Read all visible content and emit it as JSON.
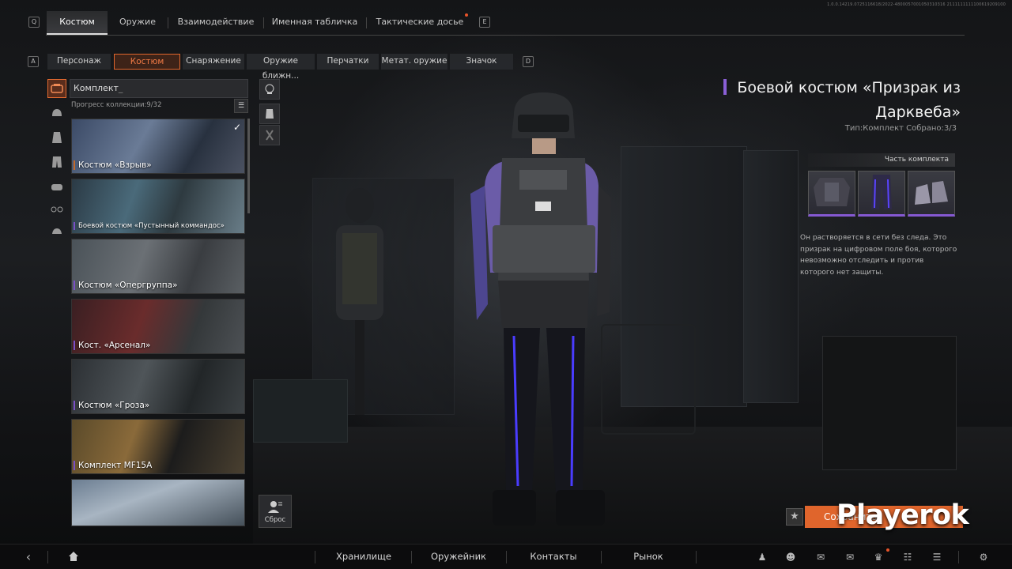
{
  "top_tabs": [
    {
      "key": "Q"
    },
    {
      "label": "Костюм",
      "active": true
    },
    {
      "label": "Оружие"
    },
    {
      "label": "Взаимодействие"
    },
    {
      "label": "Именная табличка"
    },
    {
      "label": "Тактические досье"
    },
    {
      "key": "E"
    }
  ],
  "top_keys": {
    "left": "Q",
    "right": "E"
  },
  "version_text": "1.0.0.14219.0725116618/2022-4800057001050310316 2111111111100619209100",
  "sub_keys": {
    "left": "A",
    "right": "D"
  },
  "sub_tabs": [
    {
      "label": "Персонаж"
    },
    {
      "label": "Костюм",
      "active": true
    },
    {
      "label": "Снаряжение"
    },
    {
      "label": "Оружие ближн..."
    },
    {
      "label": "Перчатки"
    },
    {
      "label": "Метат. оружие"
    },
    {
      "label": "Значок"
    }
  ],
  "categories": [
    "suit-icon",
    "helmet-icon",
    "jacket-icon",
    "pants-icon",
    "gloves-icon",
    "mask-icon",
    "glasses-icon",
    "cap-icon"
  ],
  "collection": {
    "filter_label": "Комплект",
    "progress": "Прогресс коллекции:9/32",
    "cards": [
      {
        "label": "Костюм «Взрыв»",
        "checked": true,
        "rarity": "orange"
      },
      {
        "label": "Боевой костюм «Пустынный коммандос»",
        "rarity": "purple"
      },
      {
        "label": "Костюм «Опергруппа»",
        "rarity": "purple"
      },
      {
        "label": "Кост. «Арсенал»",
        "rarity": "purple"
      },
      {
        "label": "Костюм «Гроза»",
        "rarity": "purple"
      },
      {
        "label": "Комплект MF15A",
        "rarity": "purple"
      },
      {
        "label": "",
        "rarity": "purple"
      }
    ]
  },
  "reset_label": "Сброс",
  "detail": {
    "title_line1": "Боевой костюм «Призрак из",
    "title_line2": "Дарквеба»",
    "type_line": "Тип:Комплект Собрано:3/3",
    "parts_header": "Часть комплекта",
    "parts": [
      "jacket-icon",
      "pants-icon",
      "boots-icon"
    ],
    "description": "Он растворяется в сети без следа. Это призрак на цифровом поле боя, которого невозможно отследить и против которого нет защиты.",
    "save_label": "Сохранить"
  },
  "watermark": "Playerok",
  "bottom_nav": [
    "Хранилище",
    "Оружейник",
    "Контакты",
    "Рынок"
  ],
  "bottom_icons": [
    "friends-icon",
    "profile-icon",
    "chat-icon",
    "mail-icon",
    "trophy-icon",
    "tasks-icon",
    "list-icon",
    "settings-icon"
  ],
  "colors": {
    "accent": "#e0652c",
    "rarity_purple": "#8559d2",
    "rarity_orange": "#c46a2a"
  }
}
